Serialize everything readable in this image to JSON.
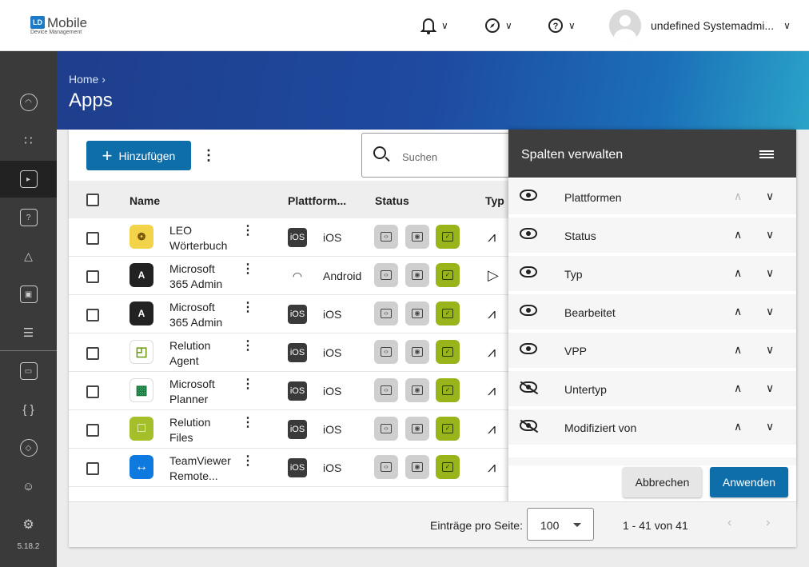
{
  "header": {
    "logo_badge": "LD",
    "logo_title": "Mobile",
    "logo_sub": "Device Management",
    "user_name": "undefined Systemadmi..."
  },
  "sidebar": {
    "version": "5.18.2",
    "items": [
      "dashboard-icon",
      "apps-grid-icon",
      "apps-icon",
      "help-icon",
      "shapes-icon",
      "briefcase-icon",
      "book-icon",
      "devices-icon",
      "code-icon",
      "graduation-icon",
      "user-settings-icon",
      "gear-icon"
    ]
  },
  "page": {
    "breadcrumb": "Home",
    "breadcrumb_sep": "›",
    "title": "Apps"
  },
  "toolbar": {
    "add_label": "Hinzufügen",
    "search_placeholder": "Suchen"
  },
  "table": {
    "columns": {
      "name": "Name",
      "platform": "Plattform...",
      "status": "Status",
      "type": "Typ"
    },
    "rows": [
      {
        "name": "LEO Wörterbuch",
        "platform": "iOS",
        "platform_badge": "iOS",
        "icon": "leo-icon"
      },
      {
        "name": "Microsoft 365 Admin",
        "platform": "Android",
        "platform_badge": "",
        "icon": "ms365-icon"
      },
      {
        "name": "Microsoft 365 Admin",
        "platform": "iOS",
        "platform_badge": "iOS",
        "icon": "ms365-icon"
      },
      {
        "name": "Relution Agent",
        "platform": "iOS",
        "platform_badge": "iOS",
        "icon": "relution-agent-icon"
      },
      {
        "name": "Microsoft Planner",
        "platform": "iOS",
        "platform_badge": "iOS",
        "icon": "planner-icon"
      },
      {
        "name": "Relution Files",
        "platform": "iOS",
        "platform_badge": "iOS",
        "icon": "relution-files-icon"
      },
      {
        "name": "TeamViewer Remote...",
        "platform": "iOS",
        "platform_badge": "iOS",
        "icon": "teamviewer-icon"
      }
    ]
  },
  "panel": {
    "title": "Spalten verwalten",
    "columns": [
      {
        "label": "Plattformen",
        "visible": true,
        "up_enabled": false
      },
      {
        "label": "Status",
        "visible": true,
        "up_enabled": true
      },
      {
        "label": "Typ",
        "visible": true,
        "up_enabled": true
      },
      {
        "label": "Bearbeitet",
        "visible": true,
        "up_enabled": true
      },
      {
        "label": "VPP",
        "visible": true,
        "up_enabled": true
      },
      {
        "label": "Untertyp",
        "visible": false,
        "up_enabled": true
      },
      {
        "label": "Modifiziert von",
        "visible": false,
        "up_enabled": true
      }
    ],
    "cancel_label": "Abbrechen",
    "apply_label": "Anwenden"
  },
  "footer": {
    "per_page_label": "Einträge pro Seite:",
    "per_page_value": "100",
    "range": "1 - 41 von 41"
  },
  "colors": {
    "primary": "#0e6eaa",
    "status_active": "#97b51b",
    "sidebar": "#3a3a3a"
  }
}
